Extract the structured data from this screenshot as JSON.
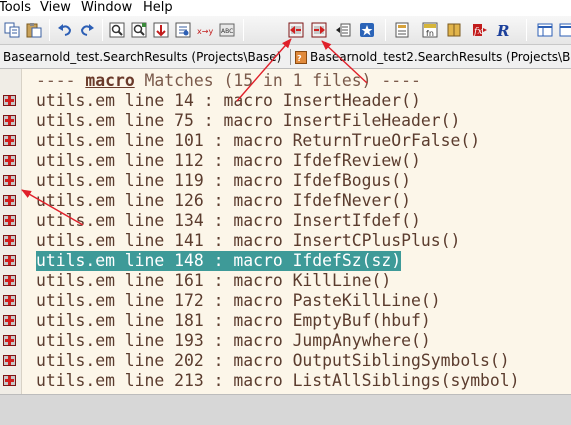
{
  "menu": [
    "Tools",
    "View",
    "Window",
    "Help"
  ],
  "toolbar": {
    "buttons": [
      {
        "name": "copy-icon"
      },
      {
        "name": "paste-icon"
      },
      {
        "name": "undo-icon"
      },
      {
        "name": "redo-icon"
      },
      {
        "name": "find-icon"
      },
      {
        "name": "find-files-icon"
      },
      {
        "name": "find-next-icon"
      },
      {
        "name": "search-results-icon"
      },
      {
        "name": "replace-icon"
      },
      {
        "name": "replace-files-icon"
      },
      {
        "name": "prev-match-icon"
      },
      {
        "name": "next-match-icon"
      },
      {
        "name": "jump-list-icon"
      },
      {
        "name": "star-icon"
      },
      {
        "name": "browse-icon"
      },
      {
        "name": "symbol-icon"
      },
      {
        "name": "book-icon"
      },
      {
        "name": "function-icon"
      },
      {
        "name": "r-icon"
      },
      {
        "name": "window-layout-icon"
      },
      {
        "name": "window-split-icon"
      }
    ]
  },
  "tabs": [
    {
      "label": "Basearnold_test.SearchResults (Projects\\Base)"
    },
    {
      "label": "Basearnold_test2.SearchResults (Projects\\Bas"
    }
  ],
  "results": {
    "header_prefix": "---- ",
    "header_keyword": "macro",
    "header_suffix": " Matches (15 in 1 files) ----",
    "lines": [
      "utils.em line 14 : macro InsertHeader()",
      "utils.em line 75 : macro InsertFileHeader()",
      "utils.em line 101 : macro ReturnTrueOrFalse()",
      "utils.em line 112 : macro IfdefReview()",
      "utils.em line 119 : macro IfdefBogus()",
      "utils.em line 126 : macro IfdefNever()",
      "utils.em line 134 : macro InsertIfdef()",
      "utils.em line 141 : macro InsertCPlusPlus()",
      "utils.em line 148 : macro IfdefSz(sz)",
      "utils.em line 161 : macro KillLine()",
      "utils.em line 172 : macro PasteKillLine()",
      "utils.em line 181 : macro EmptyBuf(hbuf)",
      "utils.em line 193 : macro JumpAnywhere()",
      "utils.em line 202 : macro OutputSiblingSymbols()",
      "utils.em line 213 : macro ListAllSiblings(symbol)"
    ],
    "selected_index": 8
  },
  "colors": {
    "editor_bg": "#fcf6e9",
    "text": "#5b3c2e",
    "selection": "#3e9a98",
    "annotation_arrow": "#e0202a"
  }
}
